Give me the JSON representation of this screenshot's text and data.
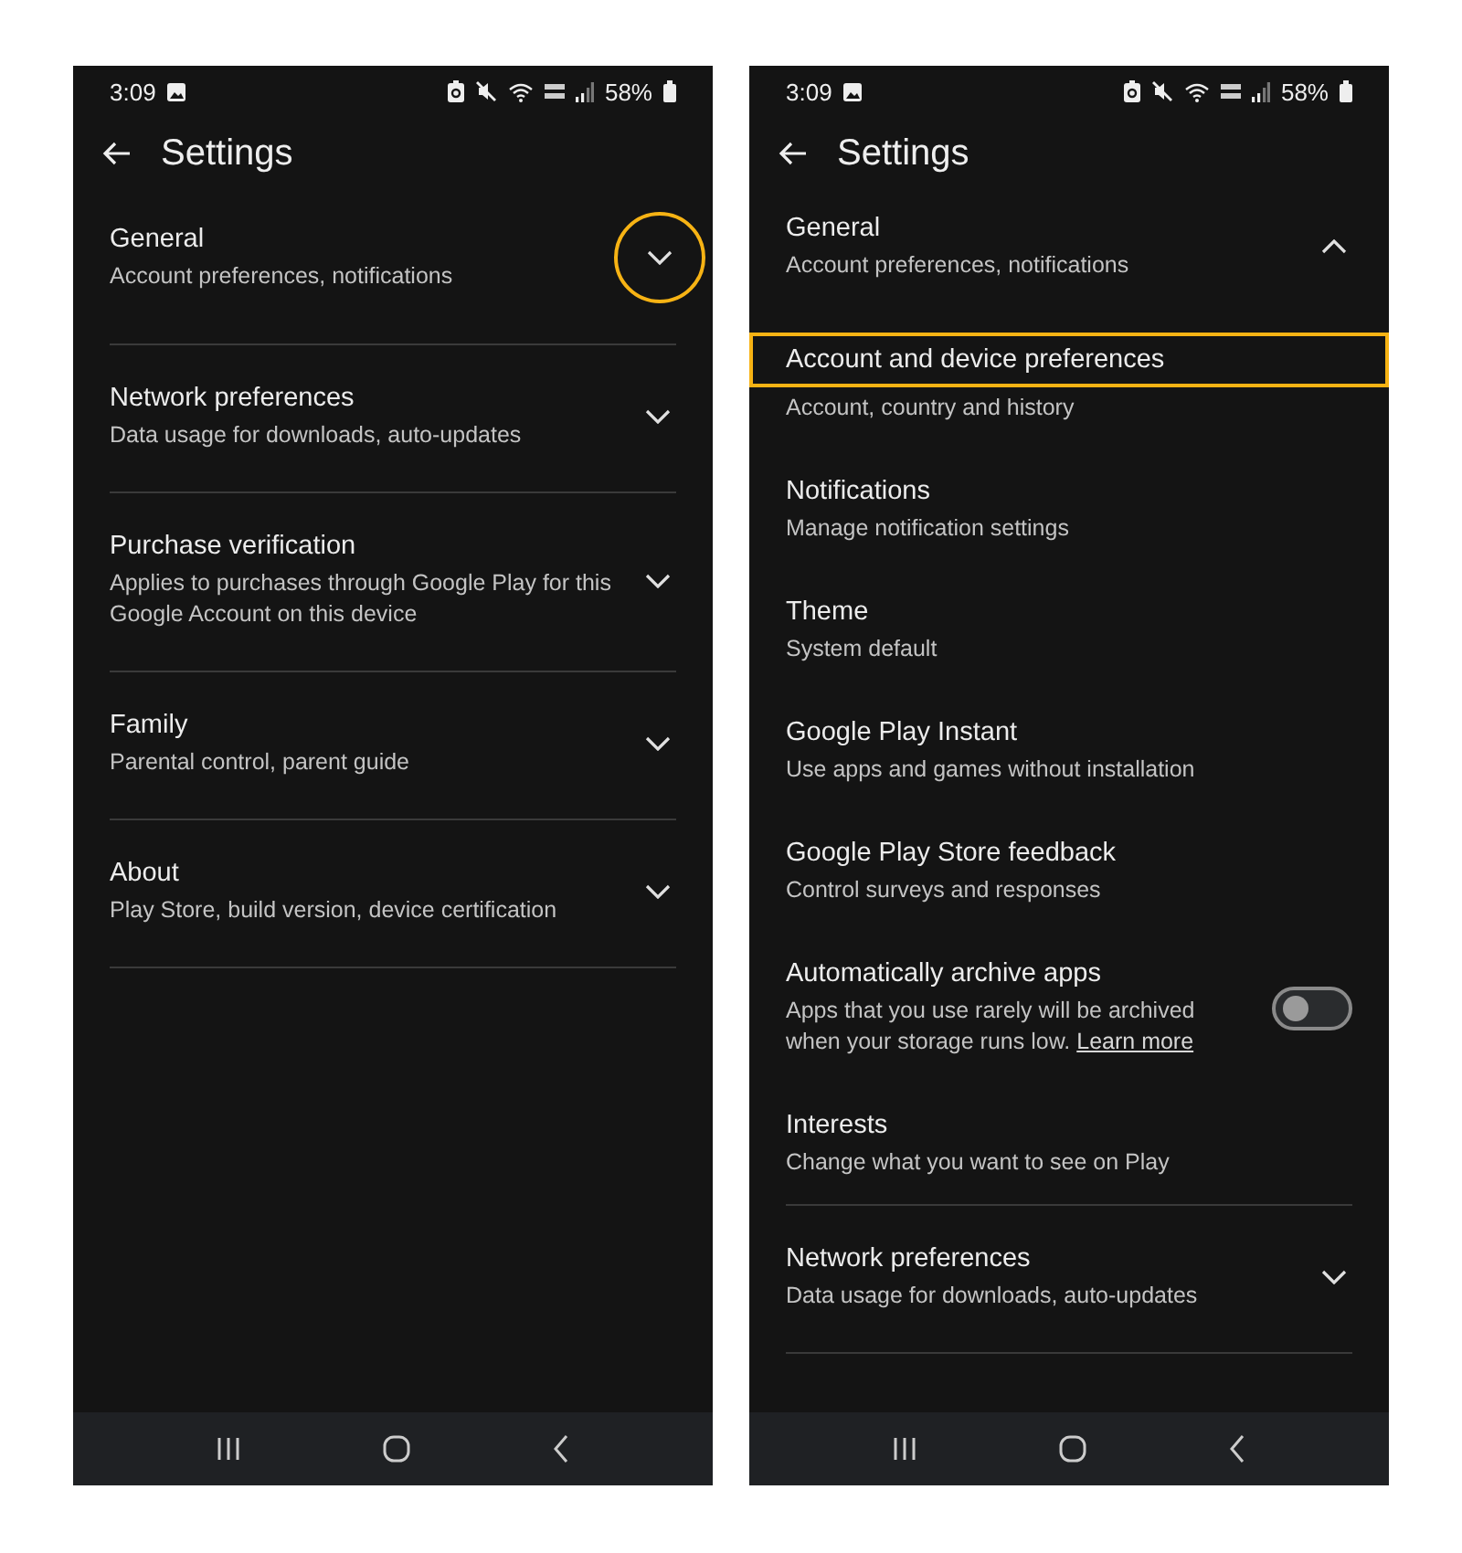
{
  "phones": [
    {
      "status_bar": {
        "time": "3:09",
        "battery": "58%"
      },
      "title": "Settings",
      "sections": [
        {
          "title": "General",
          "subtitle": "Account preferences, notifications",
          "expanded": false,
          "highlighted": true
        },
        {
          "title": "Network preferences",
          "subtitle": "Data usage for downloads, auto-updates",
          "expanded": false,
          "highlighted": false
        },
        {
          "title": "Purchase verification",
          "subtitle": "Applies to purchases through Google Play for this Google Account on this device",
          "expanded": false,
          "highlighted": false
        },
        {
          "title": "Family",
          "subtitle": "Parental control, parent guide",
          "expanded": false,
          "highlighted": false
        },
        {
          "title": "About",
          "subtitle": "Play Store, build version, device certification",
          "expanded": false,
          "highlighted": false
        }
      ]
    },
    {
      "status_bar": {
        "time": "3:09",
        "battery": "58%"
      },
      "title": "Settings",
      "sections": [
        {
          "title": "General",
          "subtitle": "Account preferences, notifications",
          "expanded": true,
          "highlighted": false,
          "items": [
            {
              "kind": "item",
              "title": "Account and device preferences",
              "subtitle": "Account, country and history",
              "highlighted": true
            },
            {
              "kind": "item",
              "title": "Notifications",
              "subtitle": "Manage notification settings",
              "highlighted": false
            },
            {
              "kind": "item",
              "title": "Theme",
              "subtitle": "System default",
              "highlighted": false
            },
            {
              "kind": "item",
              "title": "Google Play Instant",
              "subtitle": "Use apps and games without installation",
              "highlighted": false
            },
            {
              "kind": "item",
              "title": "Google Play Store feedback",
              "subtitle": "Control surveys and responses",
              "highlighted": false
            },
            {
              "kind": "toggle",
              "title": "Automatically archive apps",
              "subtitle": "Apps that you use rarely will be archived when your storage runs low.",
              "link": "Learn more",
              "on": false,
              "highlighted": false
            },
            {
              "kind": "item",
              "title": "Interests",
              "subtitle": "Change what you want to see on Play",
              "highlighted": false
            }
          ]
        },
        {
          "title": "Network preferences",
          "subtitle": "Data usage for downloads, auto-updates",
          "expanded": false,
          "highlighted": false
        }
      ]
    }
  ]
}
